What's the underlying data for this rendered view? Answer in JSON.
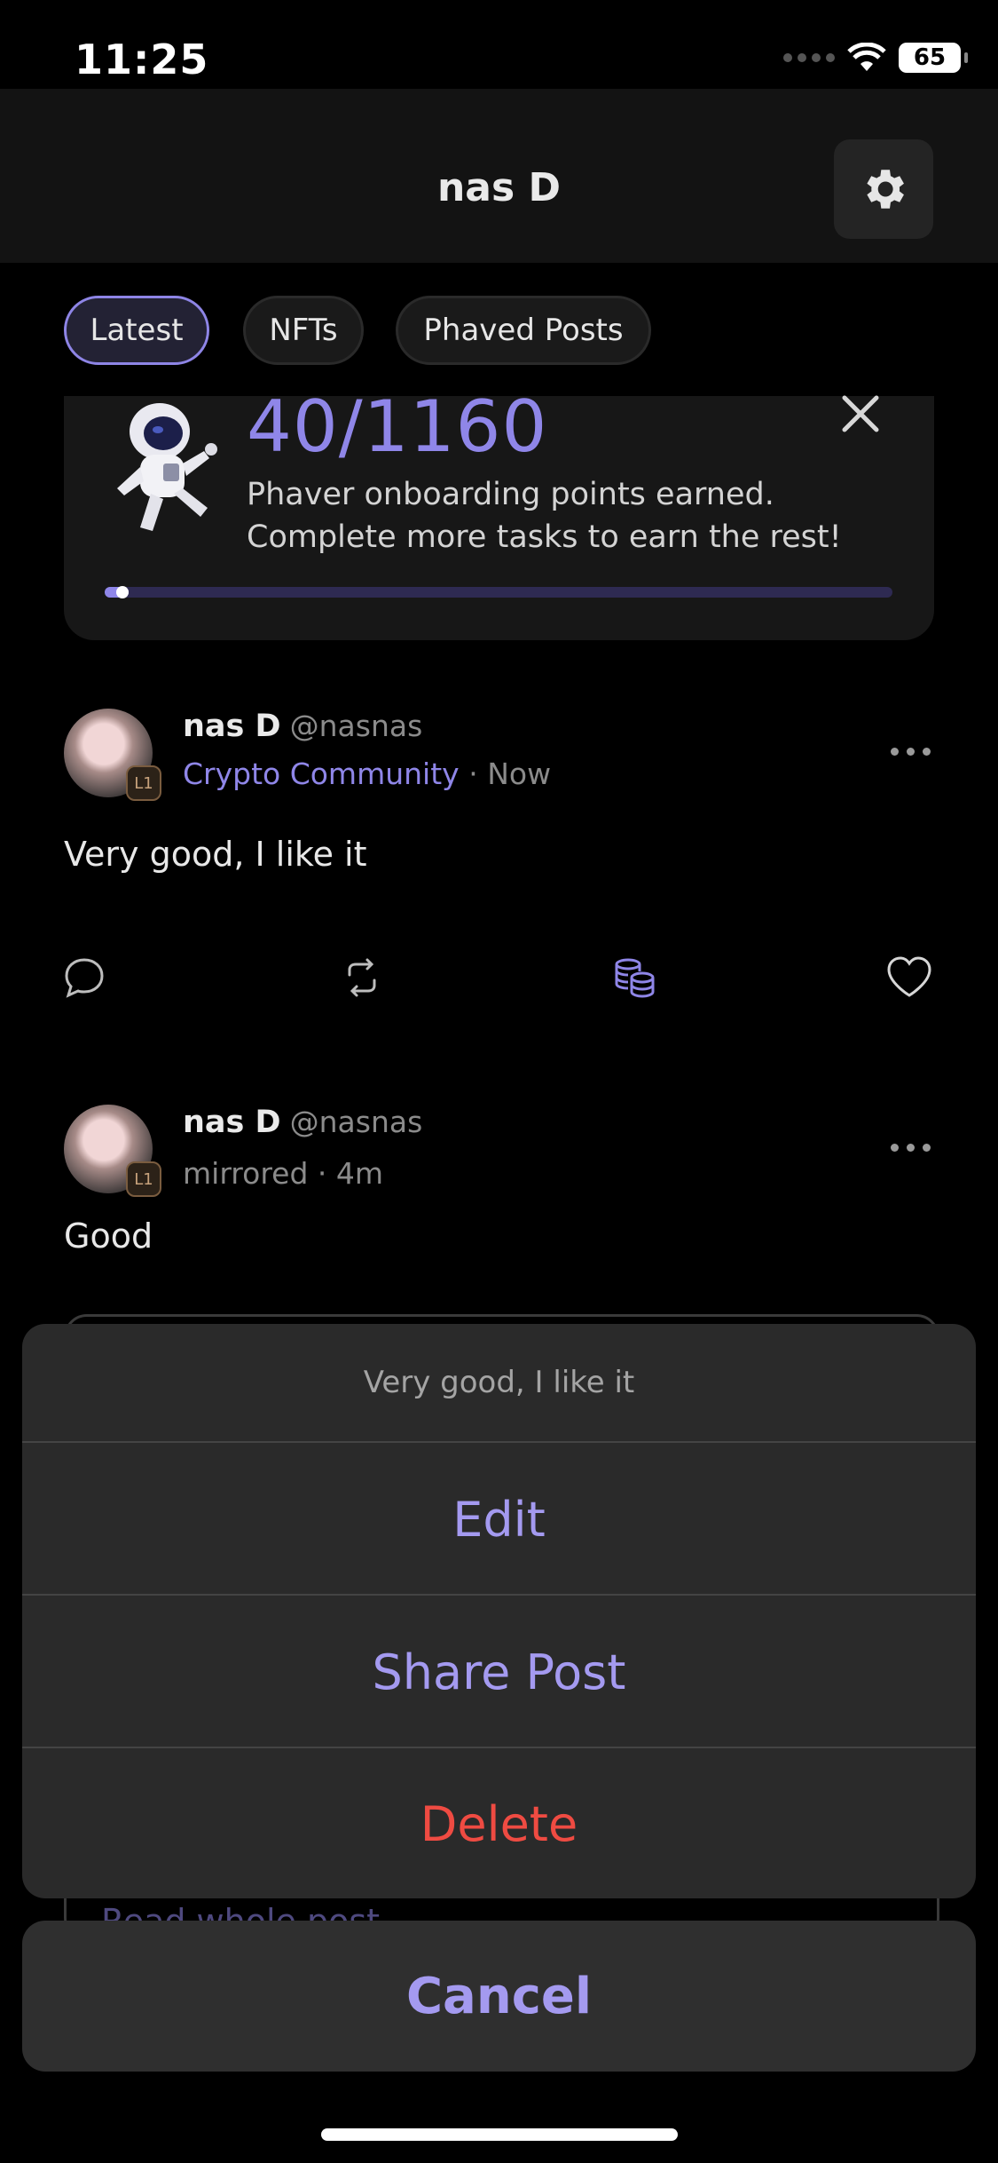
{
  "status_bar": {
    "time": "11:25",
    "battery": "65"
  },
  "header": {
    "title": "nas D",
    "settings_icon": "gear-icon"
  },
  "filters": [
    {
      "label": "Latest",
      "active": true
    },
    {
      "label": "NFTs",
      "active": false
    },
    {
      "label": "Phaved Posts",
      "active": false
    }
  ],
  "onboarding": {
    "points": "40/1160",
    "line1": "Phaver onboarding points earned.",
    "line2": "Complete more tasks to earn the rest!",
    "progress": 0.03
  },
  "posts": [
    {
      "name": "nas D",
      "handle": "@nasnas",
      "community": "Crypto Community",
      "separator": "·",
      "time": "Now",
      "badge": "L1",
      "text": "Very good, I like it"
    },
    {
      "name": "nas D",
      "handle": "@nasnas",
      "meta": "mirrored · 4m",
      "badge": "L1",
      "text": "Good"
    }
  ],
  "background": {
    "read_whole_post": "Read whole post"
  },
  "action_sheet": {
    "title": "Very good, I like it",
    "actions": [
      "Edit",
      "Share Post",
      "Delete"
    ],
    "cancel": "Cancel"
  },
  "colors": {
    "accent": "#8f86e8",
    "action": "#a49af0",
    "destructive": "#ef4b42",
    "background": "#000000"
  }
}
